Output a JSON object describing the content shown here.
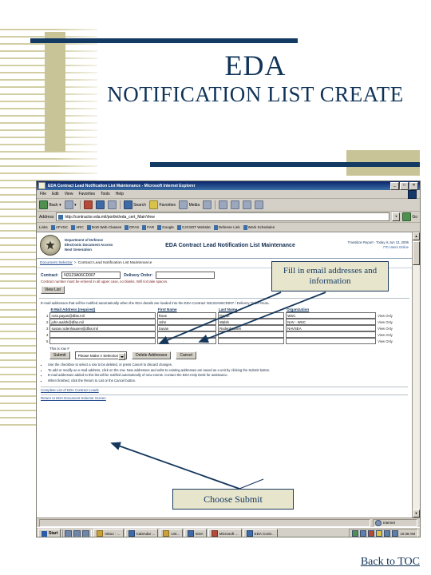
{
  "slide": {
    "title_line1": "EDA",
    "title_line2": "NOTIFICATION LIST CREATE",
    "back_link": "Back to TOC",
    "accent_navy": "#123a63",
    "accent_khaki": "#c9c497"
  },
  "callouts": {
    "fill_email": "Fill in email addresses and information",
    "choose_submit": "Choose Submit"
  },
  "browser": {
    "window_title": "EDA Contract Lead Notification List Maintenance - Microsoft Internet Explorer",
    "window_buttons": [
      "_",
      "□",
      "✕"
    ],
    "menus": [
      "File",
      "Edit",
      "View",
      "Favorites",
      "Tools",
      "Help"
    ],
    "toolbar": [
      {
        "label": "Back",
        "icon": "back-arrow-icon"
      },
      {
        "label": "",
        "icon": "forward-arrow-icon"
      },
      {
        "label": "",
        "icon": "stop-icon"
      },
      {
        "label": "",
        "icon": "refresh-icon"
      },
      {
        "label": "",
        "icon": "home-icon"
      },
      {
        "label": "Search",
        "icon": "search-icon"
      },
      {
        "label": "Favorites",
        "icon": "star-icon"
      },
      {
        "label": "Media",
        "icon": "media-icon"
      },
      {
        "label": "",
        "icon": "history-icon"
      },
      {
        "label": "",
        "icon": "mail-icon"
      },
      {
        "label": "",
        "icon": "print-icon"
      },
      {
        "label": "",
        "icon": "edit-icon"
      },
      {
        "label": "",
        "icon": "discuss-icon"
      }
    ],
    "address_label": "Address",
    "address_value": "http://contractor.eda.mil/portlet/eda_cert_MainView",
    "go_label": "Go",
    "links_label": "Links",
    "links": [
      "AFVSC",
      "ARC",
      "DoD Web Classes",
      "DFAS",
      "FAR",
      "Google",
      "CJCSDT Website",
      "Defense Link",
      "Work Schedules"
    ]
  },
  "page": {
    "org": {
      "line1": "Department of Defense",
      "line2": "Electronic Document Access",
      "line3": "Next Generation"
    },
    "banner_title": "EDA Contract Lead Notification List Maintenance",
    "date_text": "Transition Report - Today is Jun 13, 2006",
    "users_online": "770 Users Online",
    "breadcrumb": {
      "link": "Document Selector",
      "separator": ">",
      "current": "Contract Lead Notification List Maintenance"
    },
    "contract": {
      "label": "Contract:",
      "value": "N3123A06CD007",
      "placeholder": ""
    },
    "delivery_order": {
      "label": "Delivery Order:",
      "value": "",
      "placeholder": ""
    },
    "field_note": "Contract number must be entered in all upper case, no blanks. Will not take spaces.",
    "view_list_button": "View List",
    "instruction": "E-mail addresses that will be notified automatically when the EDA details are loaded into the EDA Contract N3123A06CD007 / Delivery Order NULL",
    "table": {
      "columns": [
        "E-Mail Address (required)",
        "First Name",
        "Last Name",
        "Organization"
      ],
      "view_only_label": "View Only",
      "rows": [
        {
          "num": "1",
          "email": "rose.payan@dfas.mil",
          "first": "Rose",
          "last": "Payan",
          "org": "WSC"
        },
        {
          "num": "2",
          "email": "john.walsh@dfas.mil",
          "first": "John",
          "last": "Walsh",
          "org": "NAV - WSC"
        },
        {
          "num": "3",
          "email": "susan.rodenhausen@dfas.mil",
          "first": "Susan",
          "last": "Rodenhausen",
          "org": "NAVSEA"
        },
        {
          "num": "4",
          "email": "",
          "first": "",
          "last": "",
          "org": ""
        },
        {
          "num": "5",
          "email": "",
          "first": "",
          "last": "",
          "org": ""
        }
      ]
    },
    "action": {
      "row_label": "This is row #",
      "submit_button": "Submit",
      "select_value": "Please Make A Selection",
      "delete_button": "Delete Addresses",
      "cancel_button": "Cancel"
    },
    "bullets": [
      "Use the checkbox to select a row to be deleted, or press Cancel to discard changes.",
      "To add or modify an e-mail address, click on the row. New addresses and edits to existing addresses are saved as a unit by clicking the Submit button.",
      "E-mail addresses added to this list will be notified automatically of new events. Contact the EDA Help Desk for assistance.",
      "When finished, click the Return to List or the Cancel button."
    ],
    "bullet_link_text": "Contact the EDA Help Desk",
    "footer_links": [
      "Complete List of EDA Contract Leads",
      "Return to EDA Document Selector Screen"
    ]
  },
  "statusbar": {
    "text": "",
    "zone": "Internet"
  },
  "taskbar": {
    "start_label": "Start",
    "quick_launch": [
      "desktop-icon",
      "browser-icon",
      "mail-icon"
    ],
    "tasks": [
      {
        "label": "Inbox - ...",
        "icon": "mail-icon"
      },
      {
        "label": "Calendar ...",
        "icon": "calendar-icon"
      },
      {
        "label": "Unt...",
        "icon": "folder-icon"
      },
      {
        "label": "EDA",
        "icon": "browser-icon"
      },
      {
        "label": "Microsoft ...",
        "icon": "powerpoint-icon"
      },
      {
        "label": "EDA Contr...",
        "icon": "browser-icon"
      }
    ],
    "tray_icons": [
      "network-icon",
      "volume-icon",
      "antivirus-icon",
      "update-icon",
      "security-icon",
      "printer-icon"
    ],
    "clock": "10:48 AM"
  }
}
